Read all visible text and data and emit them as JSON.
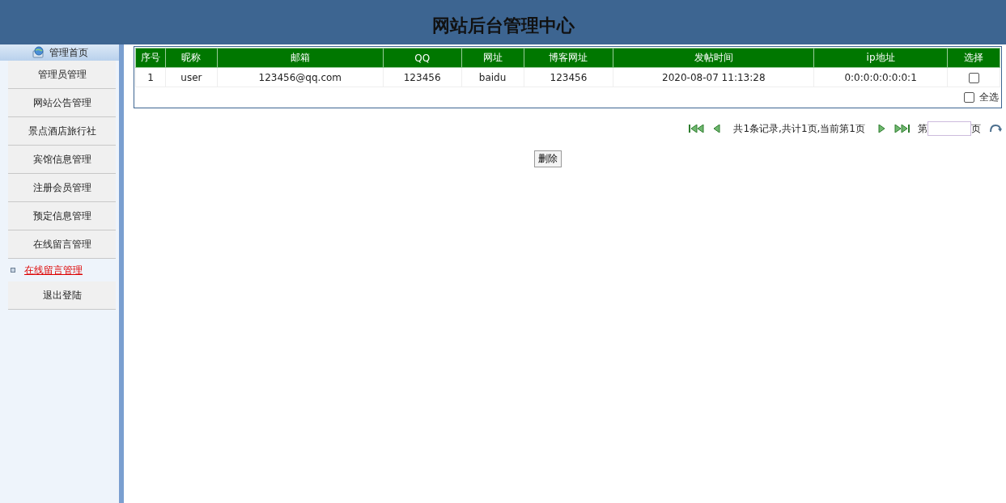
{
  "header": {
    "title": "网站后台管理中心"
  },
  "sidebar": {
    "title": "管理首页",
    "items": [
      {
        "kind": "menu",
        "label": "管理员管理"
      },
      {
        "kind": "menu",
        "label": "网站公告管理"
      },
      {
        "kind": "menu",
        "label": "景点酒店旅行社"
      },
      {
        "kind": "menu",
        "label": "宾馆信息管理"
      },
      {
        "kind": "menu",
        "label": "注册会员管理"
      },
      {
        "kind": "menu",
        "label": "预定信息管理"
      },
      {
        "kind": "menu",
        "label": "在线留言管理"
      },
      {
        "kind": "link",
        "label": "在线留言管理"
      },
      {
        "kind": "menu",
        "label": "退出登陆"
      }
    ]
  },
  "table": {
    "columns": [
      "序号",
      "昵称",
      "邮箱",
      "QQ",
      "网址",
      "博客网址",
      "发帖时间",
      "ip地址",
      "选择"
    ],
    "rows": [
      {
        "cells": [
          "1",
          "user",
          "123456@qq.com",
          "123456",
          "baidu",
          "123456",
          "2020-08-07 11:13:28",
          "0:0:0:0:0:0:0:1"
        ],
        "checked": false
      }
    ],
    "select_all": {
      "label": "全选",
      "checked": false
    }
  },
  "pagination": {
    "summary": "共1条记录,共计1页,当前第1页",
    "page_prefix": "第",
    "page_suffix": "页"
  },
  "delete_button": "删除"
}
